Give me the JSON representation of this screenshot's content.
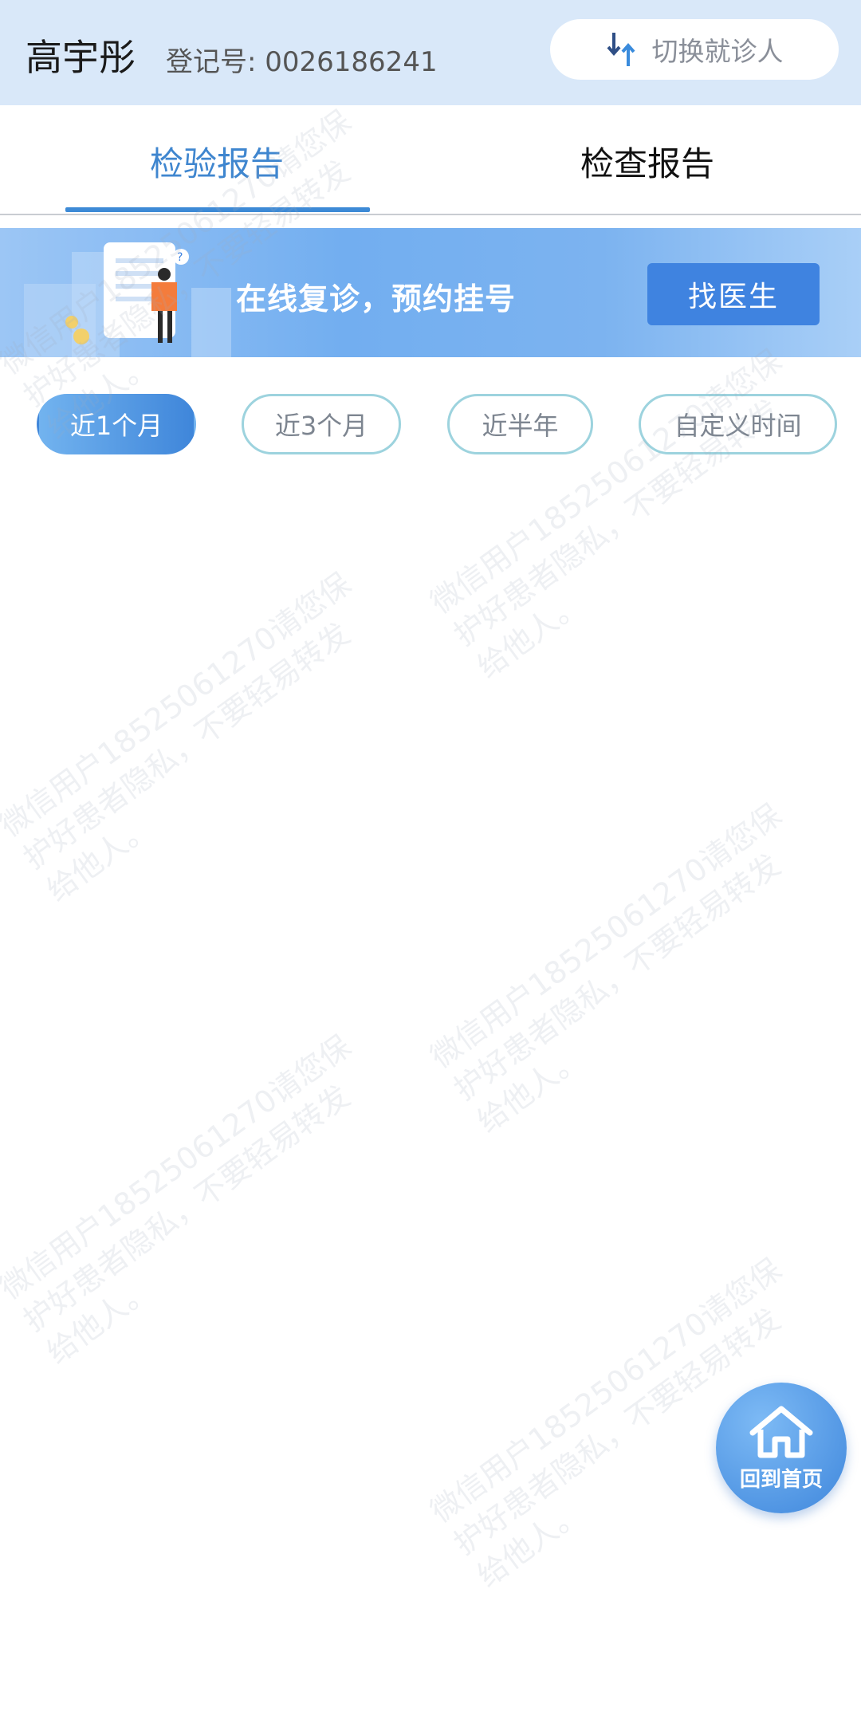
{
  "header": {
    "patient_name": "高宇彤",
    "registration": "登记号: 0026186241",
    "switch_label": "切换就诊人",
    "switch_icon": "swap-arrows-icon"
  },
  "tabs": [
    {
      "label": "检验报告",
      "active": true
    },
    {
      "label": "检查报告",
      "active": false
    }
  ],
  "banner": {
    "text": "在线复诊，预约挂号",
    "button_label": "找医生"
  },
  "filters": [
    {
      "label": "近1个月",
      "active": true
    },
    {
      "label": "近3个月",
      "active": false
    },
    {
      "label": "近半年",
      "active": false
    },
    {
      "label": "自定义时间",
      "active": false
    }
  ],
  "watermark": {
    "line1": "微信用户18525061270请您保",
    "line2": "护好患者隐私，不要轻易转发",
    "line3": "给他人。"
  },
  "home_button": {
    "label": "回到首页",
    "icon": "home-icon"
  },
  "colors": {
    "header_bg": "#d9e8f9",
    "accent": "#3f86cf",
    "filter_border": "#9dd3de"
  }
}
